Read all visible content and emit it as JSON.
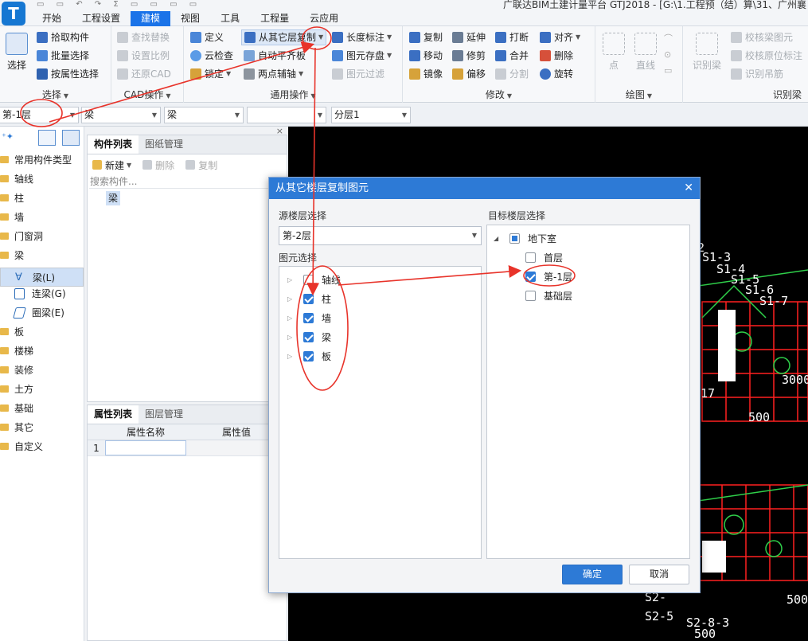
{
  "app": {
    "logo": "T",
    "title": "广联达BIM土建计量平台 GTJ2018 - [G:\\1.工程预（结）算\\31、广州襄"
  },
  "menu": [
    "开始",
    "工程设置",
    "建模",
    "视图",
    "工具",
    "工程量",
    "云应用"
  ],
  "ribbon": {
    "select": {
      "big": "选择",
      "items": [
        "拾取构件",
        "批量选择",
        "按属性选择"
      ],
      "label": "选择"
    },
    "cad": {
      "items": [
        "查找替换",
        "设置比例",
        "还原CAD"
      ],
      "label": "CAD操作"
    },
    "common": {
      "col1": [
        "定义",
        "云检查",
        "锁定"
      ],
      "col2": [
        "从其它层复制",
        "自动平齐板",
        "两点辅轴"
      ],
      "col3": [
        "长度标注",
        "图元存盘",
        "图元过滤"
      ],
      "label": "通用操作"
    },
    "modify": {
      "col1": [
        "复制",
        "移动",
        "镜像"
      ],
      "col2": [
        "延伸",
        "修剪",
        "偏移"
      ],
      "col3": [
        "打断",
        "合并",
        "分割"
      ],
      "col4": [
        "对齐",
        "删除",
        "旋转"
      ],
      "label": "修改"
    },
    "draw": {
      "items": [
        "点",
        "直线"
      ],
      "label": "绘图"
    },
    "beam": {
      "big": "识别梁",
      "items": [
        "校核梁图元",
        "校核原位标注",
        "识别吊筋"
      ],
      "label": "识别梁"
    }
  },
  "selbar": {
    "floor": "第-1层",
    "type1": "梁",
    "type2": "梁",
    "type3": "",
    "layer": "分层1"
  },
  "tree": {
    "items": [
      "常用构件类型",
      "轴线",
      "柱",
      "墙",
      "门窗洞",
      "梁"
    ],
    "children": [
      "梁(L)",
      "连梁(G)",
      "圈梁(E)"
    ],
    "items2": [
      "板",
      "楼梯",
      "装修",
      "土方",
      "基础",
      "其它",
      "自定义"
    ]
  },
  "component_panel": {
    "tabs": [
      "构件列表",
      "图纸管理"
    ],
    "tools": [
      "新建",
      "删除",
      "复制"
    ],
    "search_placeholder": "搜索构件...",
    "items": [
      "梁"
    ]
  },
  "property_panel": {
    "tabs": [
      "属性列表",
      "图层管理"
    ],
    "headers": [
      "属性名称",
      "属性值"
    ],
    "rows": [
      "1"
    ]
  },
  "canvas": {
    "labels": [
      "2",
      "S1-3",
      "S1-4",
      "S1-5",
      "S1-6",
      "S1-7",
      "3000",
      "500",
      "17",
      "500",
      "S2-",
      "S2-5",
      "S2-8-3",
      "500"
    ]
  },
  "dialog": {
    "title": "从其它楼层复制图元",
    "source_label": "源楼层选择",
    "source_value": "第-2层",
    "element_label": "图元选择",
    "elements": [
      {
        "name": "轴线",
        "checked": false
      },
      {
        "name": "柱",
        "checked": true
      },
      {
        "name": "墙",
        "checked": true
      },
      {
        "name": "梁",
        "checked": true
      },
      {
        "name": "板",
        "checked": true
      }
    ],
    "target_label": "目标楼层选择",
    "target_root": "地下室",
    "targets": [
      {
        "name": "首层",
        "checked": false
      },
      {
        "name": "第-1层",
        "checked": true
      },
      {
        "name": "基础层",
        "checked": false
      }
    ],
    "ok": "确定",
    "cancel": "取消"
  },
  "colors": {
    "accent": "#2d7ad6",
    "annotation": "#e8332a",
    "cad_red": "#ff2020",
    "cad_green": "#2fd04a"
  }
}
